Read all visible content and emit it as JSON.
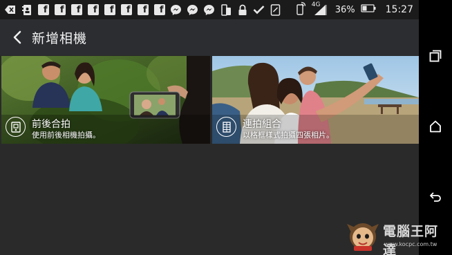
{
  "status_bar": {
    "left_icons": [
      "back-arrow-notification-icon",
      "phonebook-icon",
      "facebook-icon",
      "facebook-icon",
      "facebook-icon",
      "facebook-icon",
      "facebook-icon",
      "facebook-icon",
      "facebook-icon",
      "facebook-icon",
      "messenger-icon",
      "messenger-icon",
      "messenger-icon",
      "screen-rotate-icon",
      "lock-icon",
      "check-icon",
      "phone-card-icon"
    ],
    "network": "4G",
    "battery": "36%",
    "time": "15:27"
  },
  "app_bar": {
    "title": "新增相機"
  },
  "options": [
    {
      "title": "前後合拍",
      "subtitle": "使用前後相機拍攝。",
      "icon": "front-back-camera-icon"
    },
    {
      "title": "連拍組合",
      "subtitle": "以格框樣式拍攝四張相片。",
      "icon": "photo-booth-grid-icon"
    }
  ],
  "nav_bar": {
    "buttons": [
      "recent-apps-icon",
      "home-icon",
      "back-icon"
    ]
  },
  "watermark": {
    "text": "電腦王阿達",
    "url": "www.kocpc.com.tw"
  },
  "colors": {
    "status_bar": "#1b1b1b",
    "app_bar": "#2b2d31",
    "background": "#2a2a2a",
    "nav_bar": "#000000"
  }
}
